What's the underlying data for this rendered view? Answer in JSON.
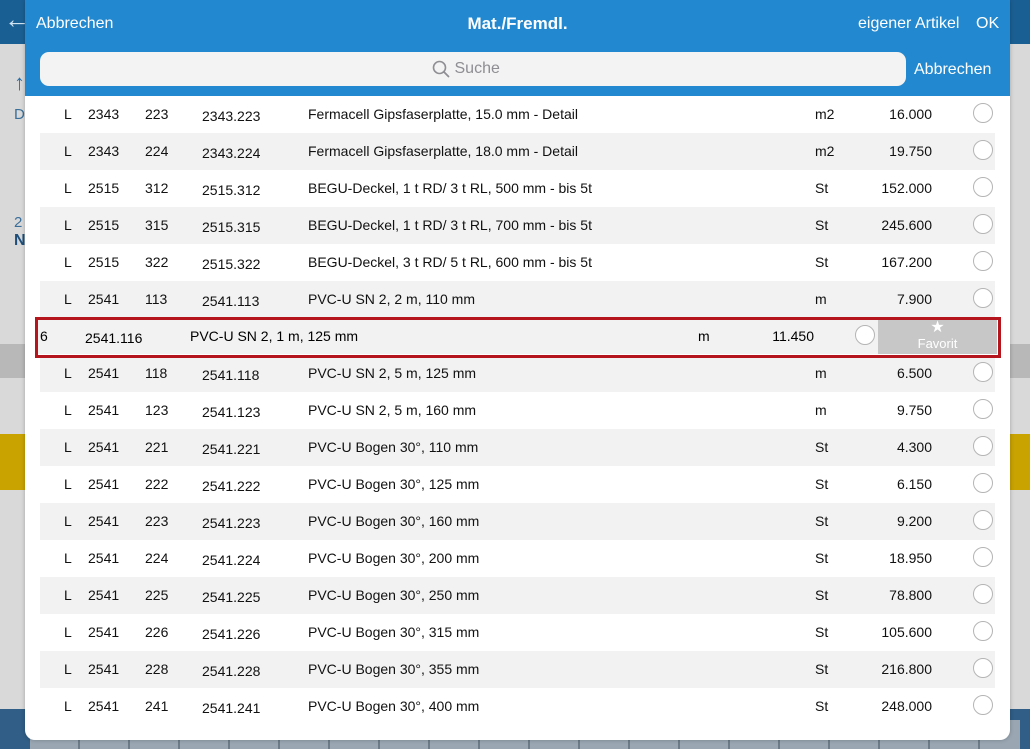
{
  "modal": {
    "title": "Mat./Fremdl.",
    "cancel_label": "Abbrechen",
    "own_article_label": "eigener Artikel",
    "ok_label": "OK",
    "search_placeholder": "Suche",
    "search_cancel_label": "Abbrechen"
  },
  "background": {
    "text1": "D",
    "text2": "2",
    "text3": "N"
  },
  "rows_top": [
    {
      "type": "L",
      "group": "2343",
      "sub": "223",
      "code": "2343.223",
      "description": "Fermacell Gipsfaserplatte, 15.0 mm - Detail",
      "unit": "m2",
      "price": "16.000"
    },
    {
      "type": "L",
      "group": "2343",
      "sub": "224",
      "code": "2343.224",
      "description": "Fermacell Gipsfaserplatte, 18.0 mm - Detail",
      "unit": "m2",
      "price": "19.750"
    },
    {
      "type": "L",
      "group": "2515",
      "sub": "312",
      "code": "2515.312",
      "description": "BEGU-Deckel, 1 t RD/  3 t RL, 500 mm - bis 5t",
      "unit": "St",
      "price": "152.000"
    },
    {
      "type": "L",
      "group": "2515",
      "sub": "315",
      "code": "2515.315",
      "description": "BEGU-Deckel, 1 t RD/  3 t RL, 700 mm - bis 5t",
      "unit": "St",
      "price": "245.600"
    },
    {
      "type": "L",
      "group": "2515",
      "sub": "322",
      "code": "2515.322",
      "description": "BEGU-Deckel, 3 t RD/  5 t RL, 600 mm - bis 5t",
      "unit": "St",
      "price": "167.200"
    },
    {
      "type": "L",
      "group": "2541",
      "sub": "113",
      "code": "2541.113",
      "description": "PVC-U SN 2, 2 m, 110 mm",
      "unit": "m",
      "price": "7.900"
    }
  ],
  "swiped_row": {
    "sub_fragment": "6",
    "code": "2541.116",
    "description": "PVC-U SN 2, 1 m, 125 mm",
    "unit": "m",
    "price": "11.450",
    "favorite_star": "★",
    "favorite_label": "Favorit"
  },
  "rows_bottom": [
    {
      "type": "L",
      "group": "2541",
      "sub": "118",
      "code": "2541.118",
      "description": "PVC-U SN 2, 5 m, 125 mm",
      "unit": "m",
      "price": "6.500"
    },
    {
      "type": "L",
      "group": "2541",
      "sub": "123",
      "code": "2541.123",
      "description": "PVC-U SN 2, 5 m, 160 mm",
      "unit": "m",
      "price": "9.750"
    },
    {
      "type": "L",
      "group": "2541",
      "sub": "221",
      "code": "2541.221",
      "description": "PVC-U Bogen 30°, 110 mm",
      "unit": "St",
      "price": "4.300"
    },
    {
      "type": "L",
      "group": "2541",
      "sub": "222",
      "code": "2541.222",
      "description": "PVC-U Bogen 30°, 125 mm",
      "unit": "St",
      "price": "6.150"
    },
    {
      "type": "L",
      "group": "2541",
      "sub": "223",
      "code": "2541.223",
      "description": "PVC-U Bogen 30°, 160 mm",
      "unit": "St",
      "price": "9.200"
    },
    {
      "type": "L",
      "group": "2541",
      "sub": "224",
      "code": "2541.224",
      "description": "PVC-U Bogen 30°, 200 mm",
      "unit": "St",
      "price": "18.950"
    },
    {
      "type": "L",
      "group": "2541",
      "sub": "225",
      "code": "2541.225",
      "description": "PVC-U Bogen 30°, 250 mm",
      "unit": "St",
      "price": "78.800"
    },
    {
      "type": "L",
      "group": "2541",
      "sub": "226",
      "code": "2541.226",
      "description": "PVC-U Bogen 30°, 315 mm",
      "unit": "St",
      "price": "105.600"
    },
    {
      "type": "L",
      "group": "2541",
      "sub": "228",
      "code": "2541.228",
      "description": "PVC-U Bogen 30°, 355 mm",
      "unit": "St",
      "price": "216.800"
    },
    {
      "type": "L",
      "group": "2541",
      "sub": "241",
      "code": "2541.241",
      "description": "PVC-U Bogen 30°, 400 mm",
      "unit": "St",
      "price": "248.000"
    }
  ],
  "colors": {
    "header_blue": "#2288cf",
    "highlight_red": "#b5161e",
    "favorite_gray": "#c7c7c7"
  }
}
